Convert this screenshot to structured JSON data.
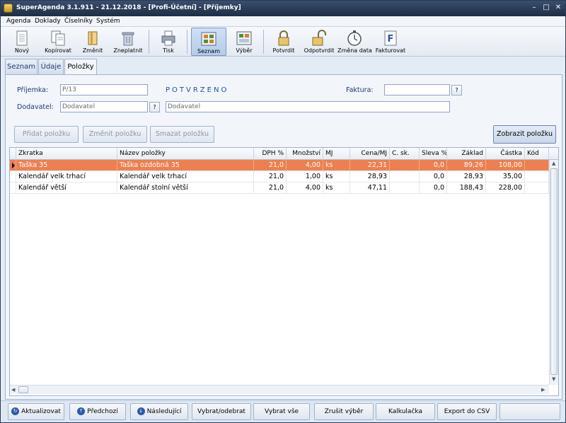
{
  "window": {
    "title": "SuperAgenda 3.1.911 - 21.12.2018 - [Profi-Účetní] - [Příjemky]",
    "controls": [
      "–",
      "□",
      "✕"
    ]
  },
  "menu": [
    "Agenda",
    "Doklady",
    "Číselníky",
    "Systém"
  ],
  "toolbar": {
    "buttons": [
      {
        "label": "Nový",
        "icon": "document-new-icon"
      },
      {
        "label": "Kopírovat",
        "icon": "copy-icon"
      },
      {
        "label": "Změnit",
        "icon": "edit-icon"
      },
      {
        "label": "Zneplatnit",
        "icon": "trash-icon"
      },
      {
        "label": "Tisk",
        "icon": "printer-icon"
      },
      {
        "label": "Seznam",
        "icon": "list-view-icon",
        "active": true
      },
      {
        "label": "Výběr",
        "icon": "filter-view-icon"
      },
      {
        "label": "Potvrdit",
        "icon": "lock-closed-icon"
      },
      {
        "label": "Odpotvrdit",
        "icon": "lock-open-icon"
      },
      {
        "label": "Změna data",
        "icon": "stopwatch-icon"
      },
      {
        "label": "Fakturovat",
        "icon": "invoice-f-icon"
      }
    ]
  },
  "tabs": [
    {
      "label": "Seznam"
    },
    {
      "label": "Údaje"
    },
    {
      "label": "Položky",
      "active": true
    }
  ],
  "form": {
    "prijemka_label": "Příjemka:",
    "prijemka_value": "P/13",
    "status_text": "POTVRZENO",
    "faktura_label": "Faktura:",
    "faktura_value": "",
    "help_label": "?",
    "dodavatel_label": "Dodavatel:",
    "dodavatel_code": "Dodavatel",
    "dodavatel_name": "Dodavatel"
  },
  "actions": {
    "add": "Přidat položku",
    "edit": "Změnit položku",
    "delete": "Smazat položku",
    "show": "Zobrazit položku"
  },
  "grid": {
    "columns": [
      "Zkratka",
      "Název položky",
      "DPH %",
      "Množství",
      "MJ",
      "Cena/MJ",
      "C. sk.",
      "Sleva %",
      "Základ",
      "Částka",
      "Kód"
    ],
    "rows": [
      {
        "zkratka": "Taška 35",
        "nazev": "Taška ozdobná  35",
        "dph": "21,0",
        "mnozstvi": "4,00",
        "mj": "ks",
        "cena": "22,31",
        "csk": "",
        "sleva": "0,0",
        "zaklad": "89,26",
        "castka": "108,00",
        "kod": "",
        "selected": true
      },
      {
        "zkratka": "Kalendář velk trhací",
        "nazev": "Kalendář velk trhací",
        "dph": "21,0",
        "mnozstvi": "1,00",
        "mj": "ks",
        "cena": "28,93",
        "csk": "",
        "sleva": "0,0",
        "zaklad": "28,93",
        "castka": "35,00",
        "kod": ""
      },
      {
        "zkratka": "Kalendář větší",
        "nazev": "Kalendář stolní větší",
        "dph": "21,0",
        "mnozstvi": "4,00",
        "mj": "ks",
        "cena": "47,11",
        "csk": "",
        "sleva": "0,0",
        "zaklad": "188,43",
        "castka": "228,00",
        "kod": ""
      }
    ]
  },
  "bottom": {
    "refresh": "Aktualizovat",
    "prev": "Předchozí",
    "next": "Následující",
    "select_toggle": "Vybrat/odebrat",
    "select_all": "Vybrat vše",
    "cancel_select": "Zrušit výběr",
    "calculator": "Kalkulačka",
    "export": "Export do CSV",
    "empty": ""
  },
  "colors": {
    "selected_row": "#ef7f4e",
    "status_text": "#1f4fa8",
    "titlebar": "#2a3a55"
  }
}
